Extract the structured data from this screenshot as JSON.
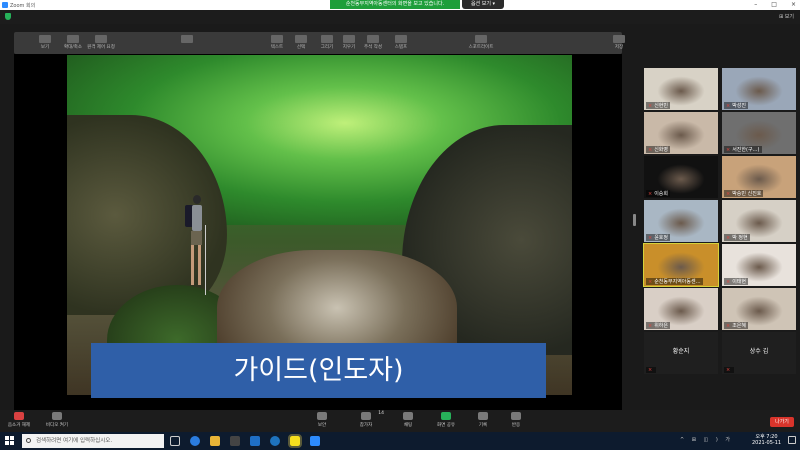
{
  "window": {
    "title": "Zoom 회의",
    "controls": [
      "–",
      "□",
      "×"
    ]
  },
  "share_banner": {
    "text": "순천동부지역아동센터의 화면을 보고 있습니다.",
    "stop_label": "옵션 보기 ▾"
  },
  "header": {
    "view_label": "⊞ 보기"
  },
  "annotation_toolbar": {
    "items": [
      {
        "label": "보기",
        "icon": "view-icon"
      },
      {
        "label": "확대/축소",
        "icon": "zoom-icon"
      },
      {
        "label": "원격 제어 요청",
        "icon": "remote-control-icon"
      },
      {
        "label": "",
        "icon": "play-icon"
      },
      {
        "label": "텍스트",
        "icon": "text-icon"
      },
      {
        "label": "선택",
        "icon": "select-icon"
      },
      {
        "label": "그리기",
        "icon": "draw-icon"
      },
      {
        "label": "지우기",
        "icon": "erase-icon"
      },
      {
        "label": "주석 작성",
        "icon": "annotate-icon"
      },
      {
        "label": "스탬프",
        "icon": "stamp-icon"
      },
      {
        "label": "스포트라이트",
        "icon": "spotlight-icon"
      },
      {
        "label": "저장",
        "icon": "save-icon"
      }
    ]
  },
  "slide": {
    "caption": "가이드(인도자)"
  },
  "participants": [
    {
      "name": "신현빈",
      "muted": true,
      "video": true,
      "bg": "#d8d2c6"
    },
    {
      "name": "박성진",
      "muted": true,
      "video": true,
      "bg": "#9aa7b8"
    },
    {
      "name": "신화영",
      "muted": true,
      "video": true,
      "bg": "#c9b9a8"
    },
    {
      "name": "서진한(구…)",
      "muted": true,
      "video": true,
      "bg": "#6f6f6f"
    },
    {
      "name": "이승희",
      "muted": true,
      "video": true,
      "bg": "#111111"
    },
    {
      "name": "박승민 신진호",
      "muted": true,
      "video": true,
      "bg": "#c8a27a"
    },
    {
      "name": "윤호정",
      "muted": true,
      "video": true,
      "bg": "#a9b7c4"
    },
    {
      "name": "박 정현",
      "muted": true,
      "video": true,
      "bg": "#d6d0c6"
    },
    {
      "name": "순천동부지역아동센…",
      "muted": true,
      "video": true,
      "bg": "#c98f2a",
      "active": true
    },
    {
      "name": "이태현",
      "muted": true,
      "video": true,
      "bg": "#e8e2dc"
    },
    {
      "name": "위하은",
      "muted": true,
      "video": true,
      "bg": "#d9cfc6"
    },
    {
      "name": "조은혜",
      "muted": true,
      "video": true,
      "bg": "#cfc4b6"
    },
    {
      "name": "황순지",
      "muted": true,
      "video": false
    },
    {
      "name": "상수 김",
      "muted": true,
      "video": false
    }
  ],
  "controls": {
    "mute": "음소거 해제",
    "video": "비디오 켜기",
    "security": "보안",
    "participants": "참가자",
    "participant_count": "14",
    "chat": "채팅",
    "share": "화면 공유",
    "record": "기록",
    "reactions": "반응",
    "leave": "나가기"
  },
  "taskbar": {
    "search_placeholder": "검색하려면 여기에 입력하십시오.",
    "time": "오후 7:20",
    "date": "2021-05-11",
    "tray": "^ ⊞ ◫ ) 가"
  }
}
